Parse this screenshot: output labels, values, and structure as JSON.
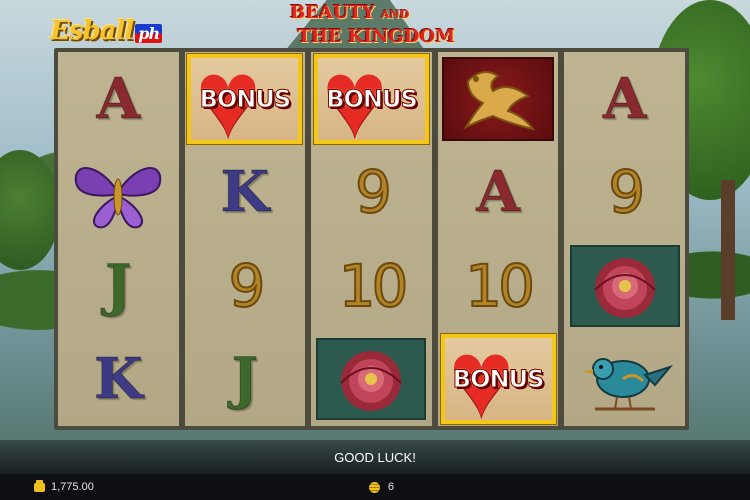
{
  "branding": {
    "logo_main": "Esball",
    "logo_suffix": "ph",
    "game_title_line1": "BEAUTY",
    "game_title_and": "AND",
    "game_title_line2": "THE KINGDOM"
  },
  "reels": [
    {
      "symbols": [
        {
          "type": "letter",
          "value": "A",
          "class": "sym-A"
        },
        {
          "type": "icon",
          "name": "butterfly-icon"
        },
        {
          "type": "letter",
          "value": "J",
          "class": "sym-J"
        },
        {
          "type": "letter",
          "value": "K",
          "class": "sym-K"
        }
      ]
    },
    {
      "symbols": [
        {
          "type": "bonus",
          "value": "BONUS"
        },
        {
          "type": "letter",
          "value": "K",
          "class": "sym-K"
        },
        {
          "type": "number",
          "value": "9"
        },
        {
          "type": "letter",
          "value": "J",
          "class": "sym-J"
        }
      ]
    },
    {
      "symbols": [
        {
          "type": "bonus",
          "value": "BONUS"
        },
        {
          "type": "number",
          "value": "9"
        },
        {
          "type": "number",
          "value": "10"
        },
        {
          "type": "icon",
          "name": "peony-icon"
        }
      ]
    },
    {
      "symbols": [
        {
          "type": "icon",
          "name": "phoenix-icon"
        },
        {
          "type": "letter",
          "value": "A",
          "class": "sym-A"
        },
        {
          "type": "number",
          "value": "10"
        },
        {
          "type": "bonus",
          "value": "BONUS"
        }
      ]
    },
    {
      "symbols": [
        {
          "type": "letter",
          "value": "A",
          "class": "sym-A"
        },
        {
          "type": "number",
          "value": "9"
        },
        {
          "type": "icon",
          "name": "peony-icon"
        },
        {
          "type": "icon",
          "name": "bird-icon"
        }
      ]
    }
  ],
  "message": "GOOD LUCK!",
  "status": {
    "balance": "1,775.00",
    "bet": "6"
  },
  "colors": {
    "bonus_border": "#f5c61a",
    "heart": "#e52b24",
    "accent_gold": "#f0c01a"
  }
}
